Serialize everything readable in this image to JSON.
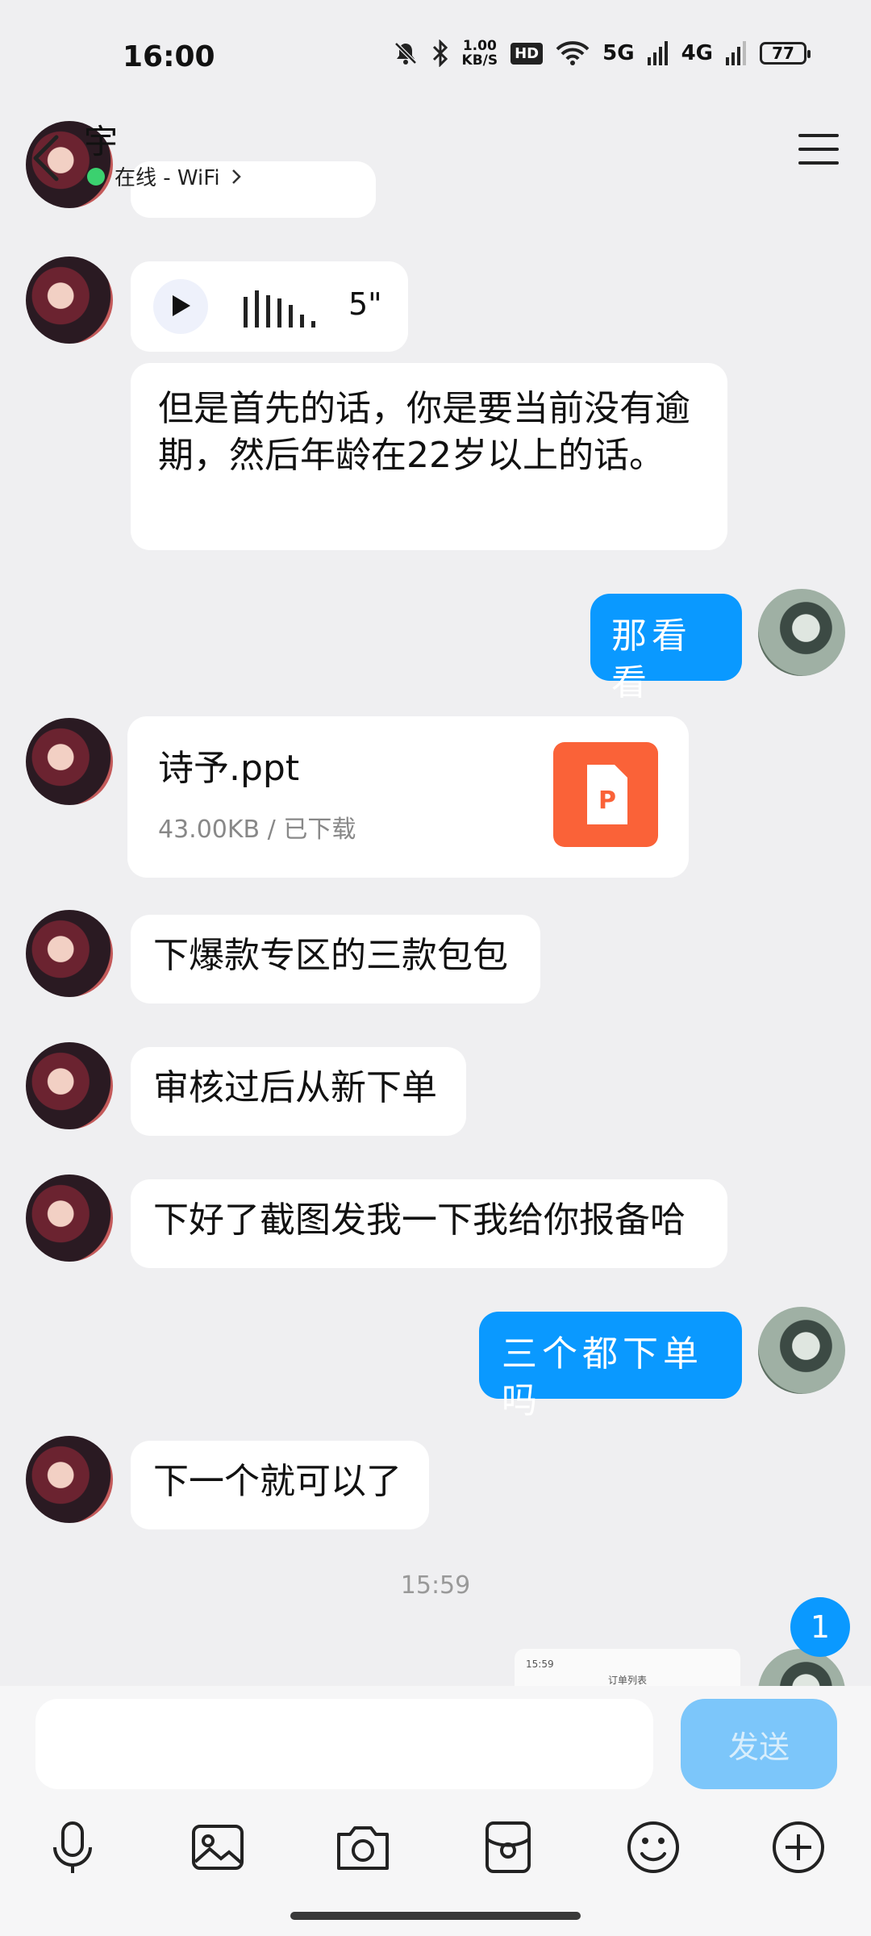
{
  "status_bar": {
    "time": "16:00",
    "speed_value": "1.00",
    "speed_unit": "KB/S",
    "hd_label": "HD",
    "net_5g": "5G",
    "net_4g": "4G",
    "battery": "77",
    "icons": [
      "mute-bell-icon",
      "bluetooth-icon",
      "wifi-icon",
      "signal-icon"
    ]
  },
  "header": {
    "contact_name": "宇",
    "status_text": "在线 - WiFi",
    "status_color": "#3bd16f"
  },
  "messages": [
    {
      "from": "her",
      "type": "voice",
      "duration": "5\""
    },
    {
      "from": "her",
      "type": "text",
      "text": "但是首先的话，你是要当前没有逾期，然后年龄在22岁以上的话。"
    },
    {
      "from": "me",
      "type": "text",
      "text": "那看看"
    },
    {
      "from": "her",
      "type": "file",
      "file_name": "诗予.ppt",
      "file_meta": "43.00KB / 已下载",
      "file_badge": "P"
    },
    {
      "from": "her",
      "type": "text",
      "text": "下爆款专区的三款包包"
    },
    {
      "from": "her",
      "type": "text",
      "text": "审核过后从新下单"
    },
    {
      "from": "her",
      "type": "text",
      "text": "下好了截图发我一下我给你报备哈"
    },
    {
      "from": "me",
      "type": "text",
      "text": "三个都下单吗"
    },
    {
      "from": "her",
      "type": "text",
      "text": "下一个就可以了"
    },
    {
      "from": "me",
      "type": "image",
      "thumb_time": "15:59",
      "thumb_title": "订单列表"
    }
  ],
  "timestamp": "15:59",
  "unread_count": "1",
  "input": {
    "placeholder": "",
    "value": ""
  },
  "send_label": "发送",
  "accent_color": "#0a99ff",
  "toolbar": [
    "microphone-icon",
    "image-icon",
    "camera-icon",
    "red-packet-icon",
    "emoji-icon",
    "plus-icon"
  ]
}
